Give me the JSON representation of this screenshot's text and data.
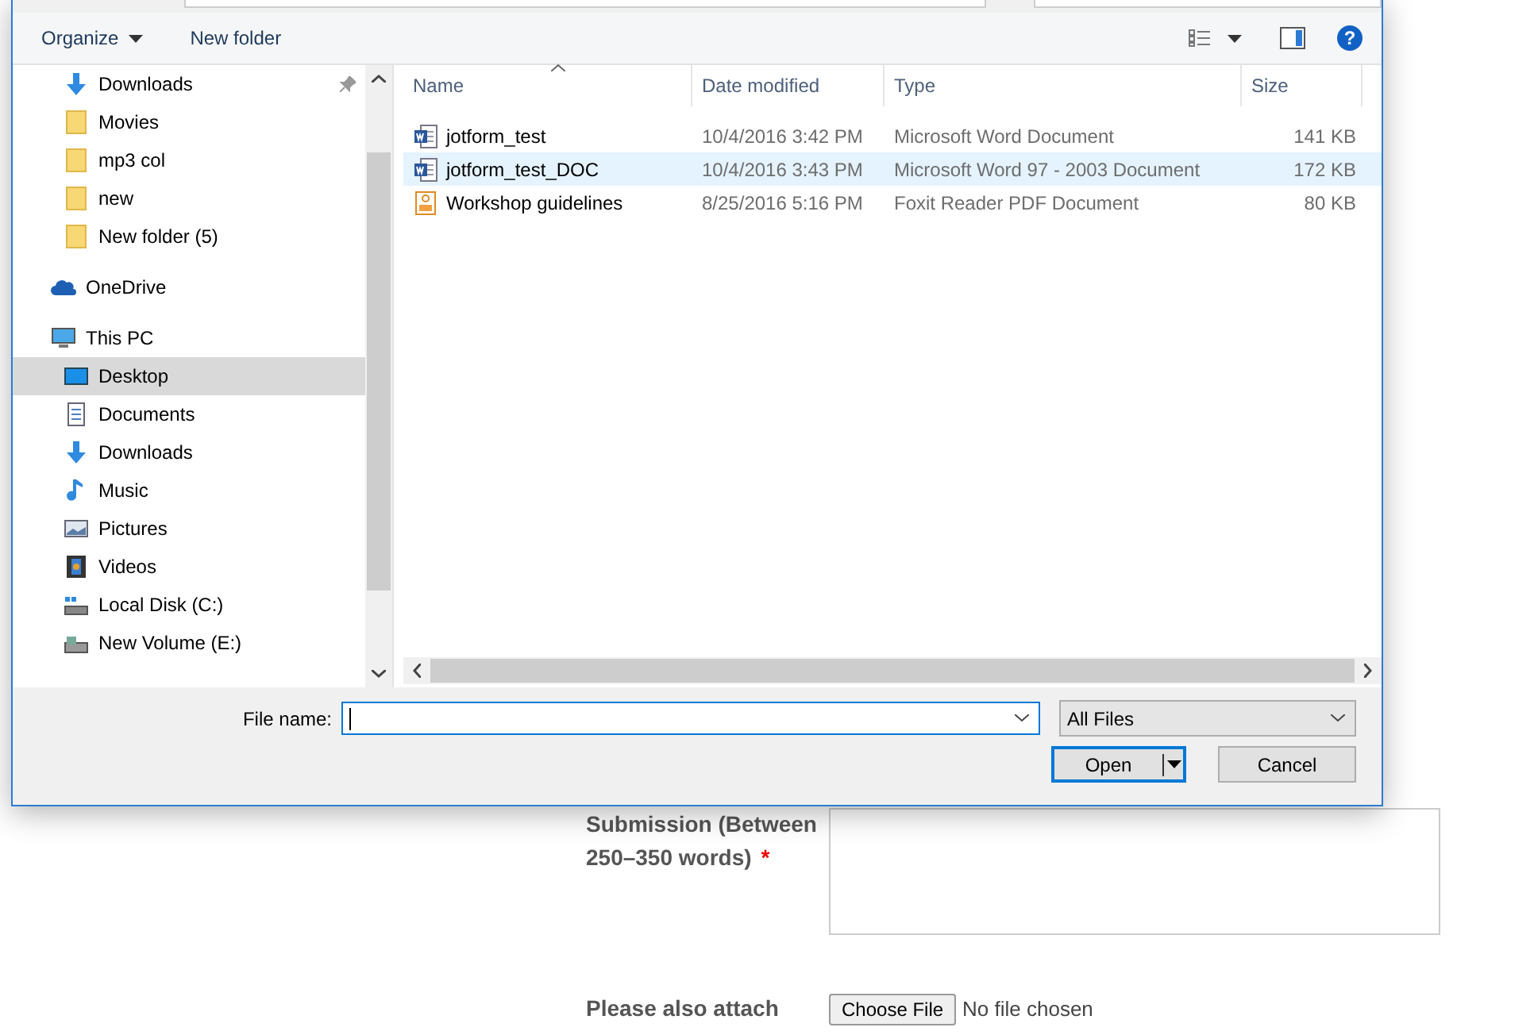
{
  "toolbar": {
    "organize": "Organize",
    "new_folder": "New folder",
    "help": "?"
  },
  "nav": [
    {
      "children": [
        {
          "label": "Downloads",
          "kind": "download",
          "pinned": true,
          "selected": false
        },
        {
          "label": "Movies",
          "kind": "folder",
          "pinned": false,
          "selected": false
        },
        {
          "label": "mp3 col",
          "kind": "folder",
          "pinned": false,
          "selected": false
        },
        {
          "label": "new",
          "kind": "folder",
          "pinned": false,
          "selected": false
        },
        {
          "label": "New folder (5)",
          "kind": "folder",
          "pinned": false,
          "selected": false
        }
      ]
    },
    {
      "label": "OneDrive",
      "kind": "cloud",
      "selected": false
    },
    {
      "label": "This PC",
      "kind": "pc",
      "selected": false,
      "children": [
        {
          "label": "Desktop",
          "kind": "desktop",
          "selected": true
        },
        {
          "label": "Documents",
          "kind": "documents",
          "selected": false
        },
        {
          "label": "Downloads",
          "kind": "download",
          "selected": false
        },
        {
          "label": "Music",
          "kind": "music",
          "selected": false
        },
        {
          "label": "Pictures",
          "kind": "pictures",
          "selected": false
        },
        {
          "label": "Videos",
          "kind": "videos",
          "selected": false
        },
        {
          "label": "Local Disk (C:)",
          "kind": "disk",
          "selected": false
        },
        {
          "label": "New Volume (E:)",
          "kind": "drive",
          "selected": false
        }
      ]
    }
  ],
  "columns": [
    "Name",
    "Date modified",
    "Type",
    "Size"
  ],
  "files": [
    {
      "name": "jotform_test",
      "date": "10/4/2016 3:42 PM",
      "type": "Microsoft Word Document",
      "size": "141 KB",
      "kind": "word",
      "selected": false
    },
    {
      "name": "jotform_test_DOC",
      "date": "10/4/2016 3:43 PM",
      "type": "Microsoft Word 97 - 2003 Document",
      "size": "172 KB",
      "kind": "word",
      "selected": true
    },
    {
      "name": "Workshop guidelines",
      "date": "8/25/2016 5:16 PM",
      "type": "Foxit Reader PDF Document",
      "size": "80 KB",
      "kind": "pdf",
      "selected": false
    }
  ],
  "file_name_label": "File name:",
  "filter": "All Files",
  "buttons": {
    "open": "Open",
    "cancel": "Cancel"
  },
  "form": {
    "submission_label": "Submission (Between 250–350 words)",
    "required_mark": "*",
    "attach_label": "Please also attach",
    "choose_file": "Choose File",
    "no_file": "No file chosen"
  }
}
